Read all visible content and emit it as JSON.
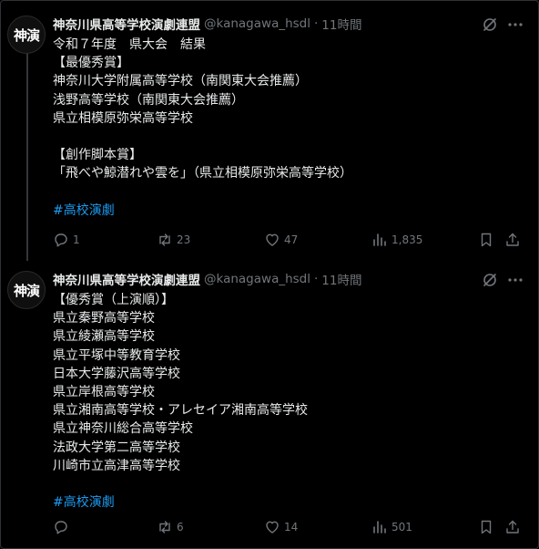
{
  "tweets": [
    {
      "avatar_text": "神演",
      "display_name": "神奈川県高等学校演劇連盟",
      "handle": "@kanagawa_hsdl",
      "separator": "·",
      "time": "11時間",
      "lines": [
        "令和７年度　県大会　結果",
        "【最優秀賞】",
        "神奈川大学附属高等学校（南関東大会推薦）",
        "浅野高等学校（南関東大会推薦）",
        "県立相模原弥栄高等学校",
        "",
        "【創作脚本賞】",
        "「飛べや鯨潜れや雲を」（県立相模原弥栄高等学校）",
        ""
      ],
      "hashtag": "#高校演劇",
      "replies": "1",
      "reposts": "23",
      "likes": "47",
      "views": "1,835"
    },
    {
      "avatar_text": "神演",
      "display_name": "神奈川県高等学校演劇連盟",
      "handle": "@kanagawa_hsdl",
      "separator": "·",
      "time": "11時間",
      "lines": [
        "【優秀賞（上演順）】",
        "県立秦野高等学校",
        "県立綾瀬高等学校",
        "県立平塚中等教育学校",
        "日本大学藤沢高等学校",
        "県立岸根高等学校",
        "県立湘南高等学校・アレセイア湘南高等学校",
        "県立神奈川総合高等学校",
        "法政大学第二高等学校",
        "川崎市立高津高等学校",
        ""
      ],
      "hashtag": "#高校演劇",
      "replies": "",
      "reposts": "6",
      "likes": "14",
      "views": "501"
    }
  ],
  "colors": {
    "background": "#000000",
    "text": "#e7e9ea",
    "muted": "#71767b",
    "link": "#1d9bf0",
    "border": "#2f3336"
  },
  "icons": [
    "grok-icon",
    "more-icon",
    "reply-icon",
    "repost-icon",
    "like-icon",
    "views-icon",
    "bookmark-icon",
    "share-icon"
  ]
}
